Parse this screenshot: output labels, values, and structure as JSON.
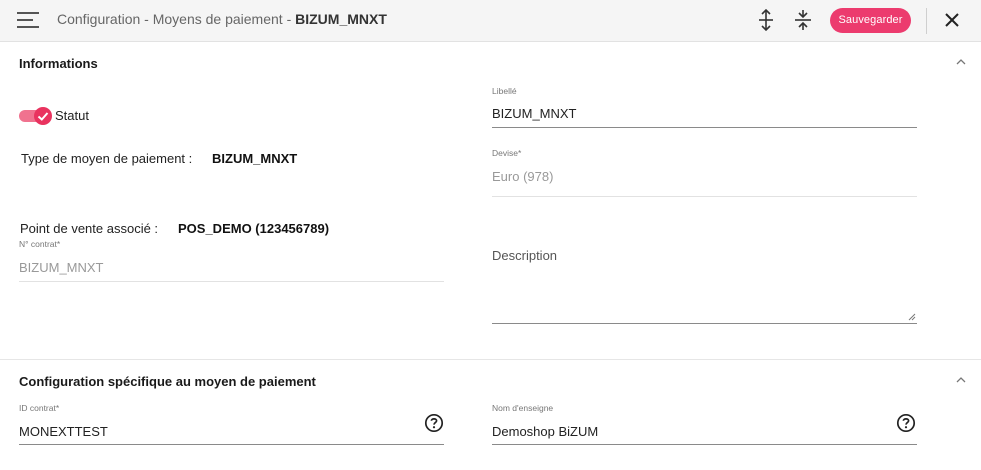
{
  "header": {
    "breadcrumb_prefix": "Configuration - Moyens de paiement - ",
    "breadcrumb_current": "BIZUM_MNXT",
    "save_label": "Sauvegarder",
    "icons": [
      "menu-icon",
      "expand-all-icon",
      "collapse-all-icon",
      "close-icon"
    ]
  },
  "informations": {
    "title": "Informations",
    "status_label": "Statut",
    "status_on": true,
    "type_label": "Type de moyen de paiement :",
    "type_value": "BIZUM_MNXT",
    "pos_label": "Point de vente associé :",
    "pos_value": "POS_DEMO (123456789)",
    "contract_label": "N° contrat*",
    "contract_value": "BIZUM_MNXT",
    "libelle_label": "Libellé",
    "libelle_value": "BIZUM_MNXT",
    "devise_label": "Devise*",
    "devise_value": "Euro (978)",
    "description_placeholder": "Description"
  },
  "config": {
    "title": "Configuration spécifique au moyen de paiement",
    "id_contract_label": "ID contrat*",
    "id_contract_value": "MONEXTTEST",
    "store_name_label": "Nom d'enseigne",
    "store_name_value": "Demoshop BiZUM"
  },
  "colors": {
    "accent": "#ec3b6e",
    "toggle_knob": "#e9335f",
    "toggle_track": "#f0728f",
    "header_bg": "#f5f5f5"
  }
}
